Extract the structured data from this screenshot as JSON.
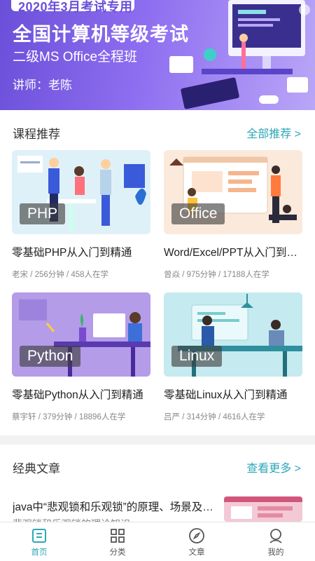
{
  "banner": {
    "tag": "2020年3月考试专用",
    "title": "全国计算机等级考试",
    "subtitle": "二级MS Office全程班",
    "teacher": "讲师：老陈"
  },
  "courses_section": {
    "title": "课程推荐",
    "more": "全部推荐 >",
    "items": [
      {
        "badge": "PHP",
        "name": "零基础PHP从入门到精通",
        "meta": "老宋 / 256分钟 / 458人在学"
      },
      {
        "badge": "Office",
        "name": "Word/Excel/PPT从入门到精通",
        "meta": "曾焱 / 975分钟 / 17188人在学"
      },
      {
        "badge": "Python",
        "name": "零基础Python从入门到精通",
        "meta": "蔡宇轩 / 379分钟 / 18896人在学"
      },
      {
        "badge": "Linux",
        "name": "零基础Linux从入门到精通",
        "meta": "吕严 / 314分钟 / 4616人在学"
      }
    ]
  },
  "articles_section": {
    "title": "经典文章",
    "more": "查看更多 >",
    "items": [
      {
        "title": "java中“悲观锁和乐观锁”的原理、场景及实现方法",
        "subtitle": "悲观锁和乐观锁的理论知识"
      }
    ]
  },
  "tabbar": {
    "tabs": [
      {
        "label": "首页",
        "icon": "home-icon",
        "active": true
      },
      {
        "label": "分类",
        "icon": "grid-icon",
        "active": false
      },
      {
        "label": "文章",
        "icon": "compass-icon",
        "active": false
      },
      {
        "label": "我的",
        "icon": "user-icon",
        "active": false
      }
    ]
  },
  "colors": {
    "accent": "#2fa7b8",
    "banner": "#7b5ee6"
  }
}
